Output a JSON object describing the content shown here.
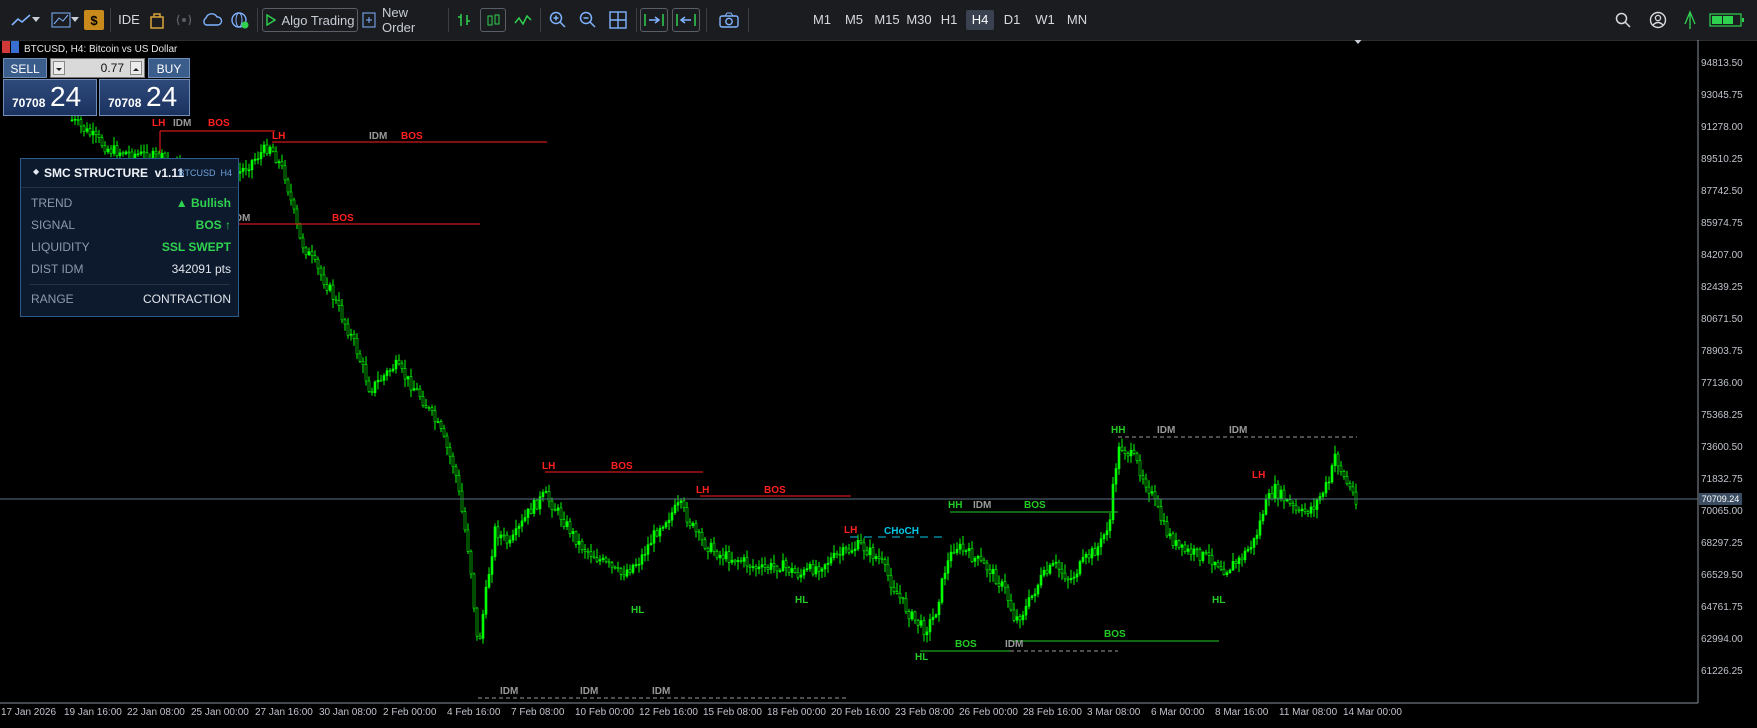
{
  "toolbar": {
    "ide_label": "IDE",
    "algo_label": "Algo Trading",
    "new_order_label": "New Order",
    "timeframes": [
      "M1",
      "M5",
      "M15",
      "M30",
      "H1",
      "H4",
      "D1",
      "W1",
      "MN"
    ],
    "active_timeframe": "H4"
  },
  "chart": {
    "title": "BTCUSD, H4:  Bitcoin vs US Dollar",
    "current_price": "70709.24",
    "bg_color": "#000000",
    "candle_color": "#00ff00",
    "bearish_structure_color": "#ff2020",
    "bullish_structure_color": "#22cc22",
    "idm_color": "#9a9a9a",
    "choch_color": "#00c8e6"
  },
  "trade_panel": {
    "sell_label": "SELL",
    "buy_label": "BUY",
    "lot": "0.77",
    "sell_price_main": "70708",
    "sell_price_big": "24",
    "buy_price_main": "70708",
    "buy_price_big": "24"
  },
  "smc_panel": {
    "title": "SMC STRUCTURE  v1.11",
    "symbol_tf": "BTCUSD  H4",
    "rows": [
      {
        "key": "TREND",
        "value": "▲ Bullish",
        "color": "#2fd24f"
      },
      {
        "key": "SIGNAL",
        "value": "BOS ↑",
        "color": "#2fd24f"
      },
      {
        "key": "LIQUIDITY",
        "value": "SSL SWEPT",
        "color": "#2fd24f"
      },
      {
        "key": "DIST IDM",
        "value": "342091 pts",
        "color": "#e0e4ea"
      },
      {
        "key": "RANGE",
        "value": "CONTRACTION",
        "color": "#e0e4ea"
      }
    ]
  },
  "price_axis": [
    "94813.50",
    "93045.75",
    "91278.00",
    "89510.25",
    "87742.50",
    "85974.75",
    "84207.00",
    "82439.25",
    "80671.50",
    "78903.75",
    "77136.00",
    "75368.25",
    "73600.50",
    "71832.75",
    "70065.00",
    "68297.25",
    "66529.50",
    "64761.75",
    "62994.00",
    "61226.25"
  ],
  "time_axis": [
    "17 Jan 2026",
    "19 Jan 16:00",
    "22 Jan 08:00",
    "25 Jan 00:00",
    "27 Jan 16:00",
    "30 Jan 08:00",
    "2 Feb 00:00",
    "4 Feb 16:00",
    "7 Feb 08:00",
    "10 Feb 00:00",
    "12 Feb 16:00",
    "15 Feb 08:00",
    "18 Feb 00:00",
    "20 Feb 16:00",
    "23 Feb 08:00",
    "26 Feb 00:00",
    "28 Feb 16:00",
    "3 Mar 08:00",
    "6 Mar 00:00",
    "8 Mar 16:00",
    "11 Mar 08:00",
    "14 Mar 00:00"
  ],
  "structure": {
    "lh": "LH",
    "hl": "HL",
    "hh": "HH",
    "idm": "IDM",
    "bos": "BOS",
    "choch": "CHoCH"
  }
}
